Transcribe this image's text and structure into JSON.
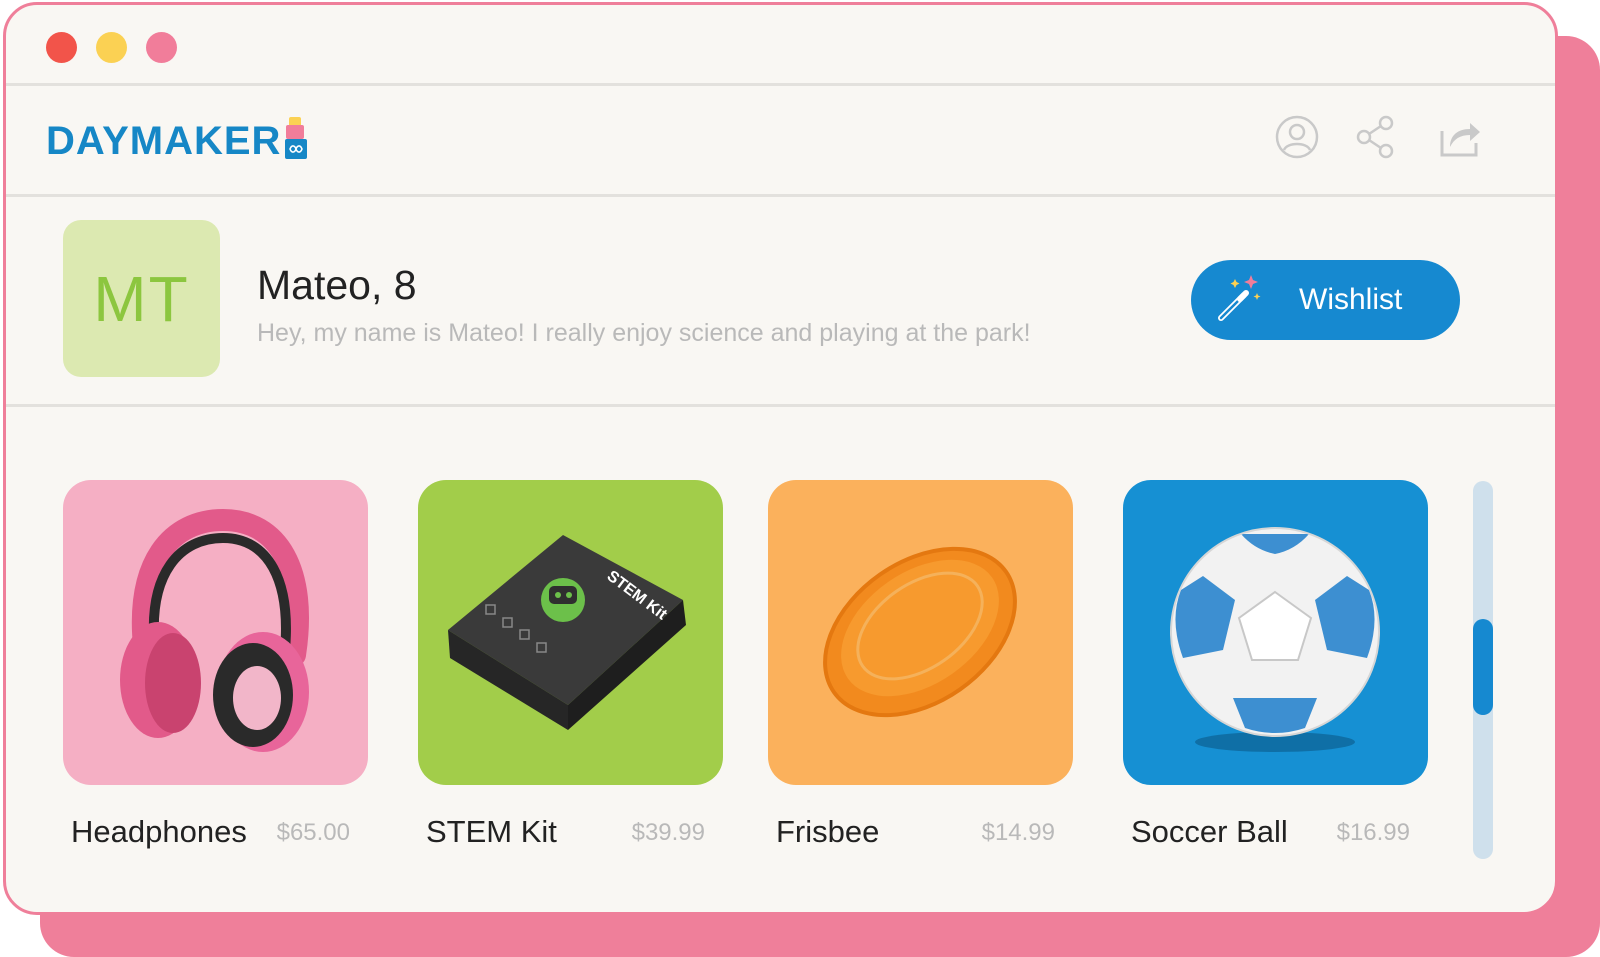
{
  "window": {
    "controls": [
      "close",
      "minimize",
      "maximize"
    ]
  },
  "header": {
    "logo_text": "DAYMAKER",
    "icons": [
      "user-icon",
      "share-icon",
      "forward-icon"
    ]
  },
  "profile": {
    "initials": "MT",
    "name": "Mateo, 8",
    "bio": "Hey, my name is Mateo! I really enjoy science and playing at the park!",
    "wishlist_label": "Wishlist"
  },
  "products": [
    {
      "name": "Headphones",
      "price": "$65.00",
      "tile_color": "#f5afc4",
      "icon": "headphones-image"
    },
    {
      "name": "STEM Kit",
      "price": "$39.99",
      "tile_color": "#a2cd4a",
      "icon": "stem-kit-image",
      "box_text": "STEM Kit"
    },
    {
      "name": "Frisbee",
      "price": "$14.99",
      "tile_color": "#fbb15c",
      "icon": "frisbee-image"
    },
    {
      "name": "Soccer Ball",
      "price": "$16.99",
      "tile_color": "#1690d3",
      "icon": "soccer-ball-image"
    }
  ],
  "colors": {
    "accent": "#1689d0",
    "frame": "#ef7f9a",
    "background": "#f9f7f3"
  }
}
